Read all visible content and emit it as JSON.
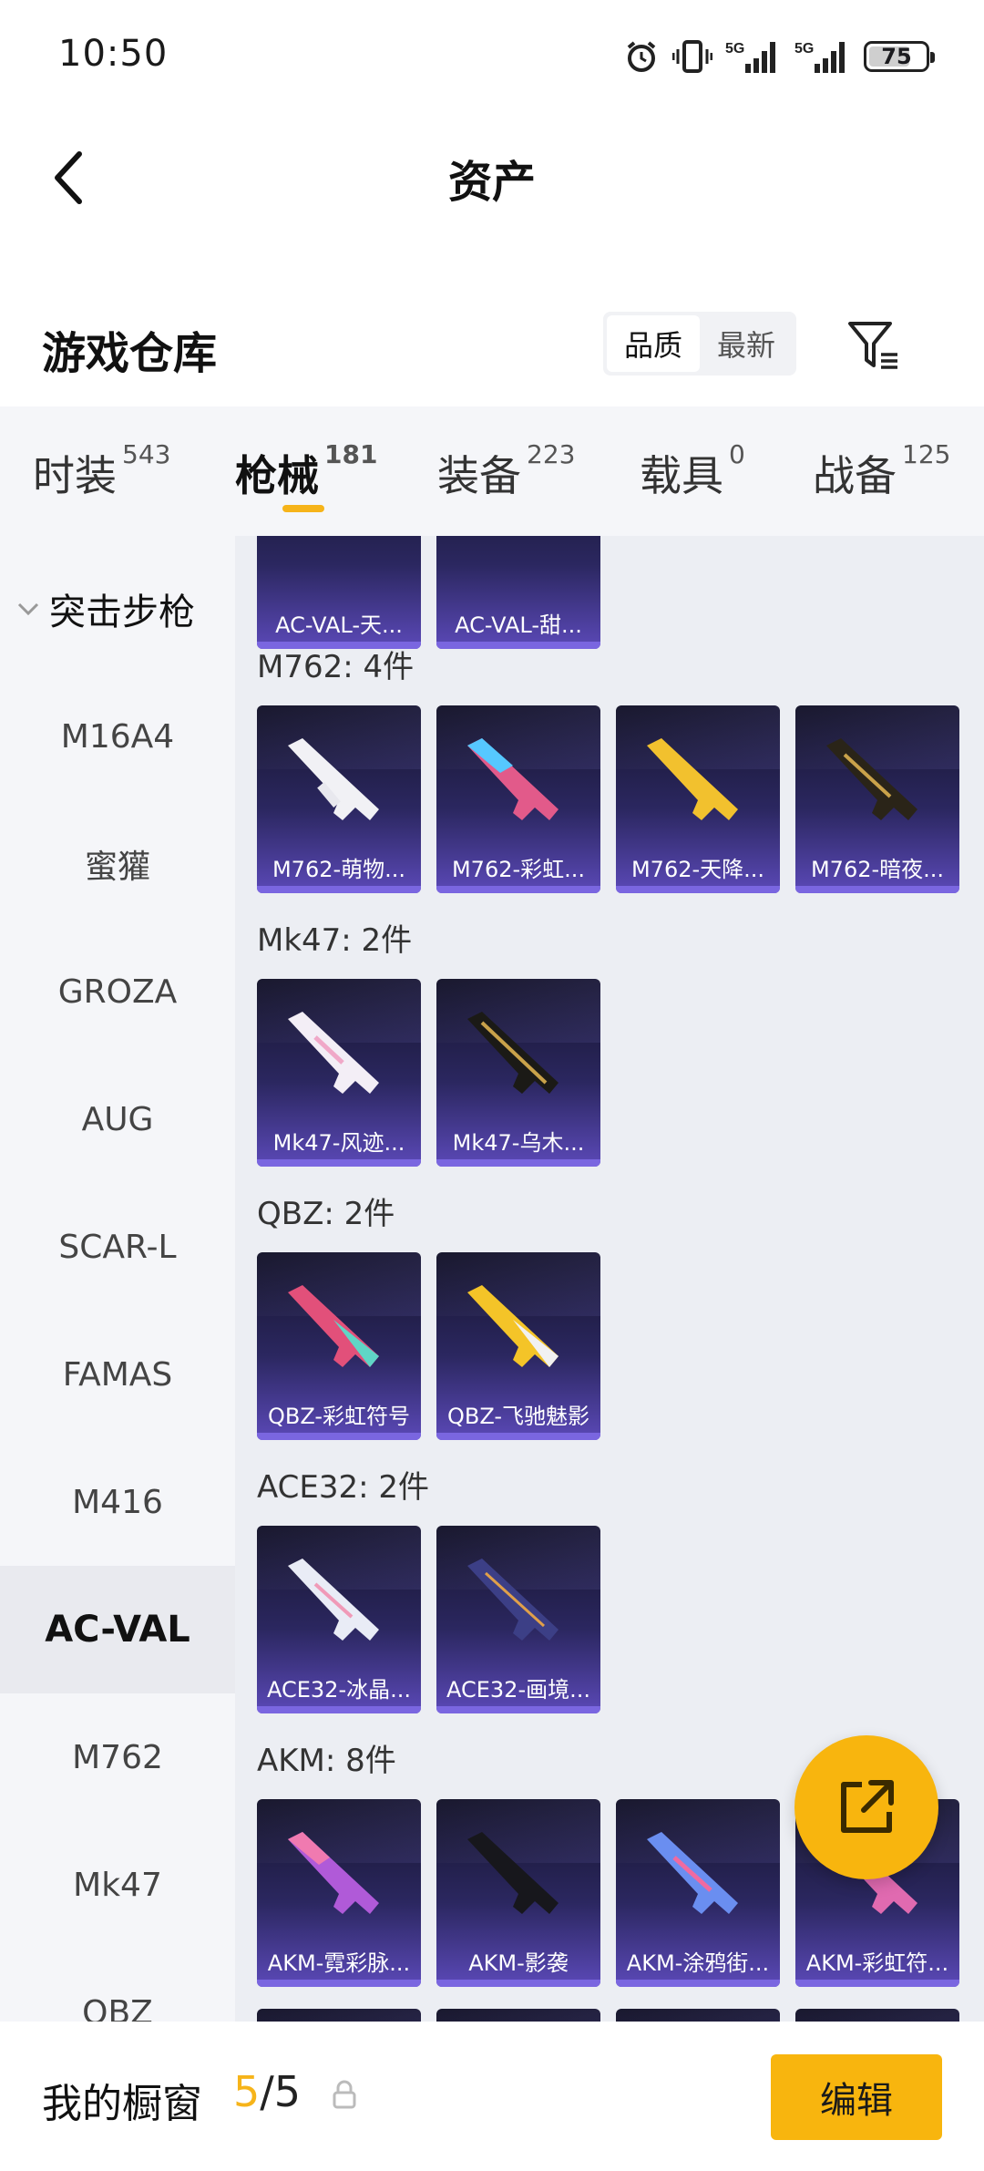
{
  "status": {
    "time": "10:50",
    "battery": "75",
    "battery_level": 0.75
  },
  "nav": {
    "title": "资产"
  },
  "warehouse": {
    "title": "游戏仓库",
    "sort_options": [
      "品质",
      "最新"
    ],
    "sort_selected": "品质"
  },
  "tabs": [
    {
      "label": "时装",
      "count": "543"
    },
    {
      "label": "枪械",
      "count": "181"
    },
    {
      "label": "装备",
      "count": "223"
    },
    {
      "label": "载具",
      "count": "0"
    },
    {
      "label": "战备",
      "count": "125"
    }
  ],
  "active_tab": "枪械",
  "sidebar": {
    "group": "突击步枪",
    "items": [
      "M16A4",
      "蜜獾",
      "GROZA",
      "AUG",
      "SCAR-L",
      "FAMAS",
      "M416",
      "AC-VAL",
      "M762",
      "Mk47",
      "QBZ"
    ],
    "active": "AC-VAL"
  },
  "content": {
    "partial_items": [
      "AC-VAL-天...",
      "AC-VAL-甜..."
    ],
    "groups": [
      {
        "label": "M762: 4件",
        "items": [
          "M762-萌物...",
          "M762-彩虹...",
          "M762-天降...",
          "M762-暗夜..."
        ]
      },
      {
        "label": "Mk47: 2件",
        "items": [
          "Mk47-风迹...",
          "Mk47-乌木..."
        ]
      },
      {
        "label": "QBZ: 2件",
        "items": [
          "QBZ-彩虹符号",
          "QBZ-飞驰魅影"
        ]
      },
      {
        "label": "ACE32: 2件",
        "items": [
          "ACE32-冰晶...",
          "ACE32-画境..."
        ]
      },
      {
        "label": "AKM: 8件",
        "items": [
          "AKM-霓彩脉...",
          "AKM-影袭",
          "AKM-涂鸦街...",
          "AKM-彩虹符..."
        ]
      }
    ]
  },
  "bottom": {
    "title": "我的橱窗",
    "count_current": "5",
    "count_sep": "/",
    "count_total": "5",
    "edit_label": "编辑"
  }
}
